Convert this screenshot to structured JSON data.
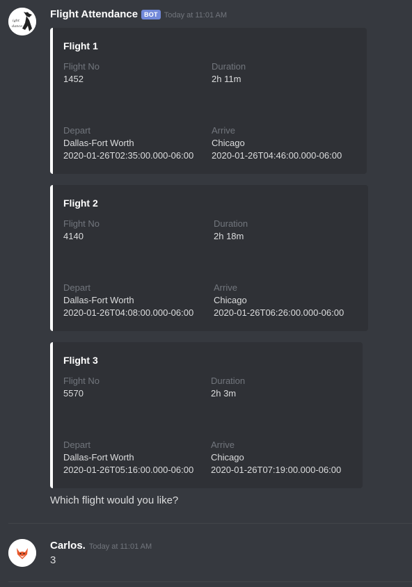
{
  "messages": [
    {
      "author": "Flight Attendance",
      "bot_tag": "BOT",
      "timestamp": "Today at 11:01 AM",
      "embeds": [
        {
          "title": "Flight 1",
          "fields": [
            {
              "name": "Flight No",
              "value": "1452"
            },
            {
              "name": "Duration",
              "value": "2h 11m"
            },
            {
              "name": "Depart",
              "value": "Dallas-Fort Worth",
              "value2": "2020-01-26T02:35:00.000-06:00"
            },
            {
              "name": "Arrive",
              "value": "Chicago",
              "value2": "2020-01-26T04:46:00.000-06:00"
            }
          ]
        },
        {
          "title": "Flight 2",
          "fields": [
            {
              "name": "Flight No",
              "value": "4140"
            },
            {
              "name": "Duration",
              "value": "2h 18m"
            },
            {
              "name": "Depart",
              "value": "Dallas-Fort Worth",
              "value2": "2020-01-26T04:08:00.000-06:00"
            },
            {
              "name": "Arrive",
              "value": "Chicago",
              "value2": "2020-01-26T06:26:00.000-06:00"
            }
          ]
        },
        {
          "title": "Flight 3",
          "fields": [
            {
              "name": "Flight No",
              "value": "5570"
            },
            {
              "name": "Duration",
              "value": "2h 3m"
            },
            {
              "name": "Depart",
              "value": "Dallas-Fort Worth",
              "value2": "2020-01-26T05:16:00.000-06:00"
            },
            {
              "name": "Arrive",
              "value": "Chicago",
              "value2": "2020-01-26T07:19:00.000-06:00"
            }
          ]
        }
      ],
      "text": "Which flight would you like?"
    },
    {
      "author": "Carlos.",
      "timestamp": "Today at 11:01 AM",
      "text": "3"
    }
  ],
  "icons": {
    "bot_avatar": "silhouette-logo-icon",
    "user_avatar": "fox-icon"
  },
  "colors": {
    "background": "#36393f",
    "embed_background": "#2f3136",
    "embed_accent": "#ffffff",
    "bot_tag": "#7289da",
    "muted": "#72767d",
    "text": "#dcddde"
  }
}
